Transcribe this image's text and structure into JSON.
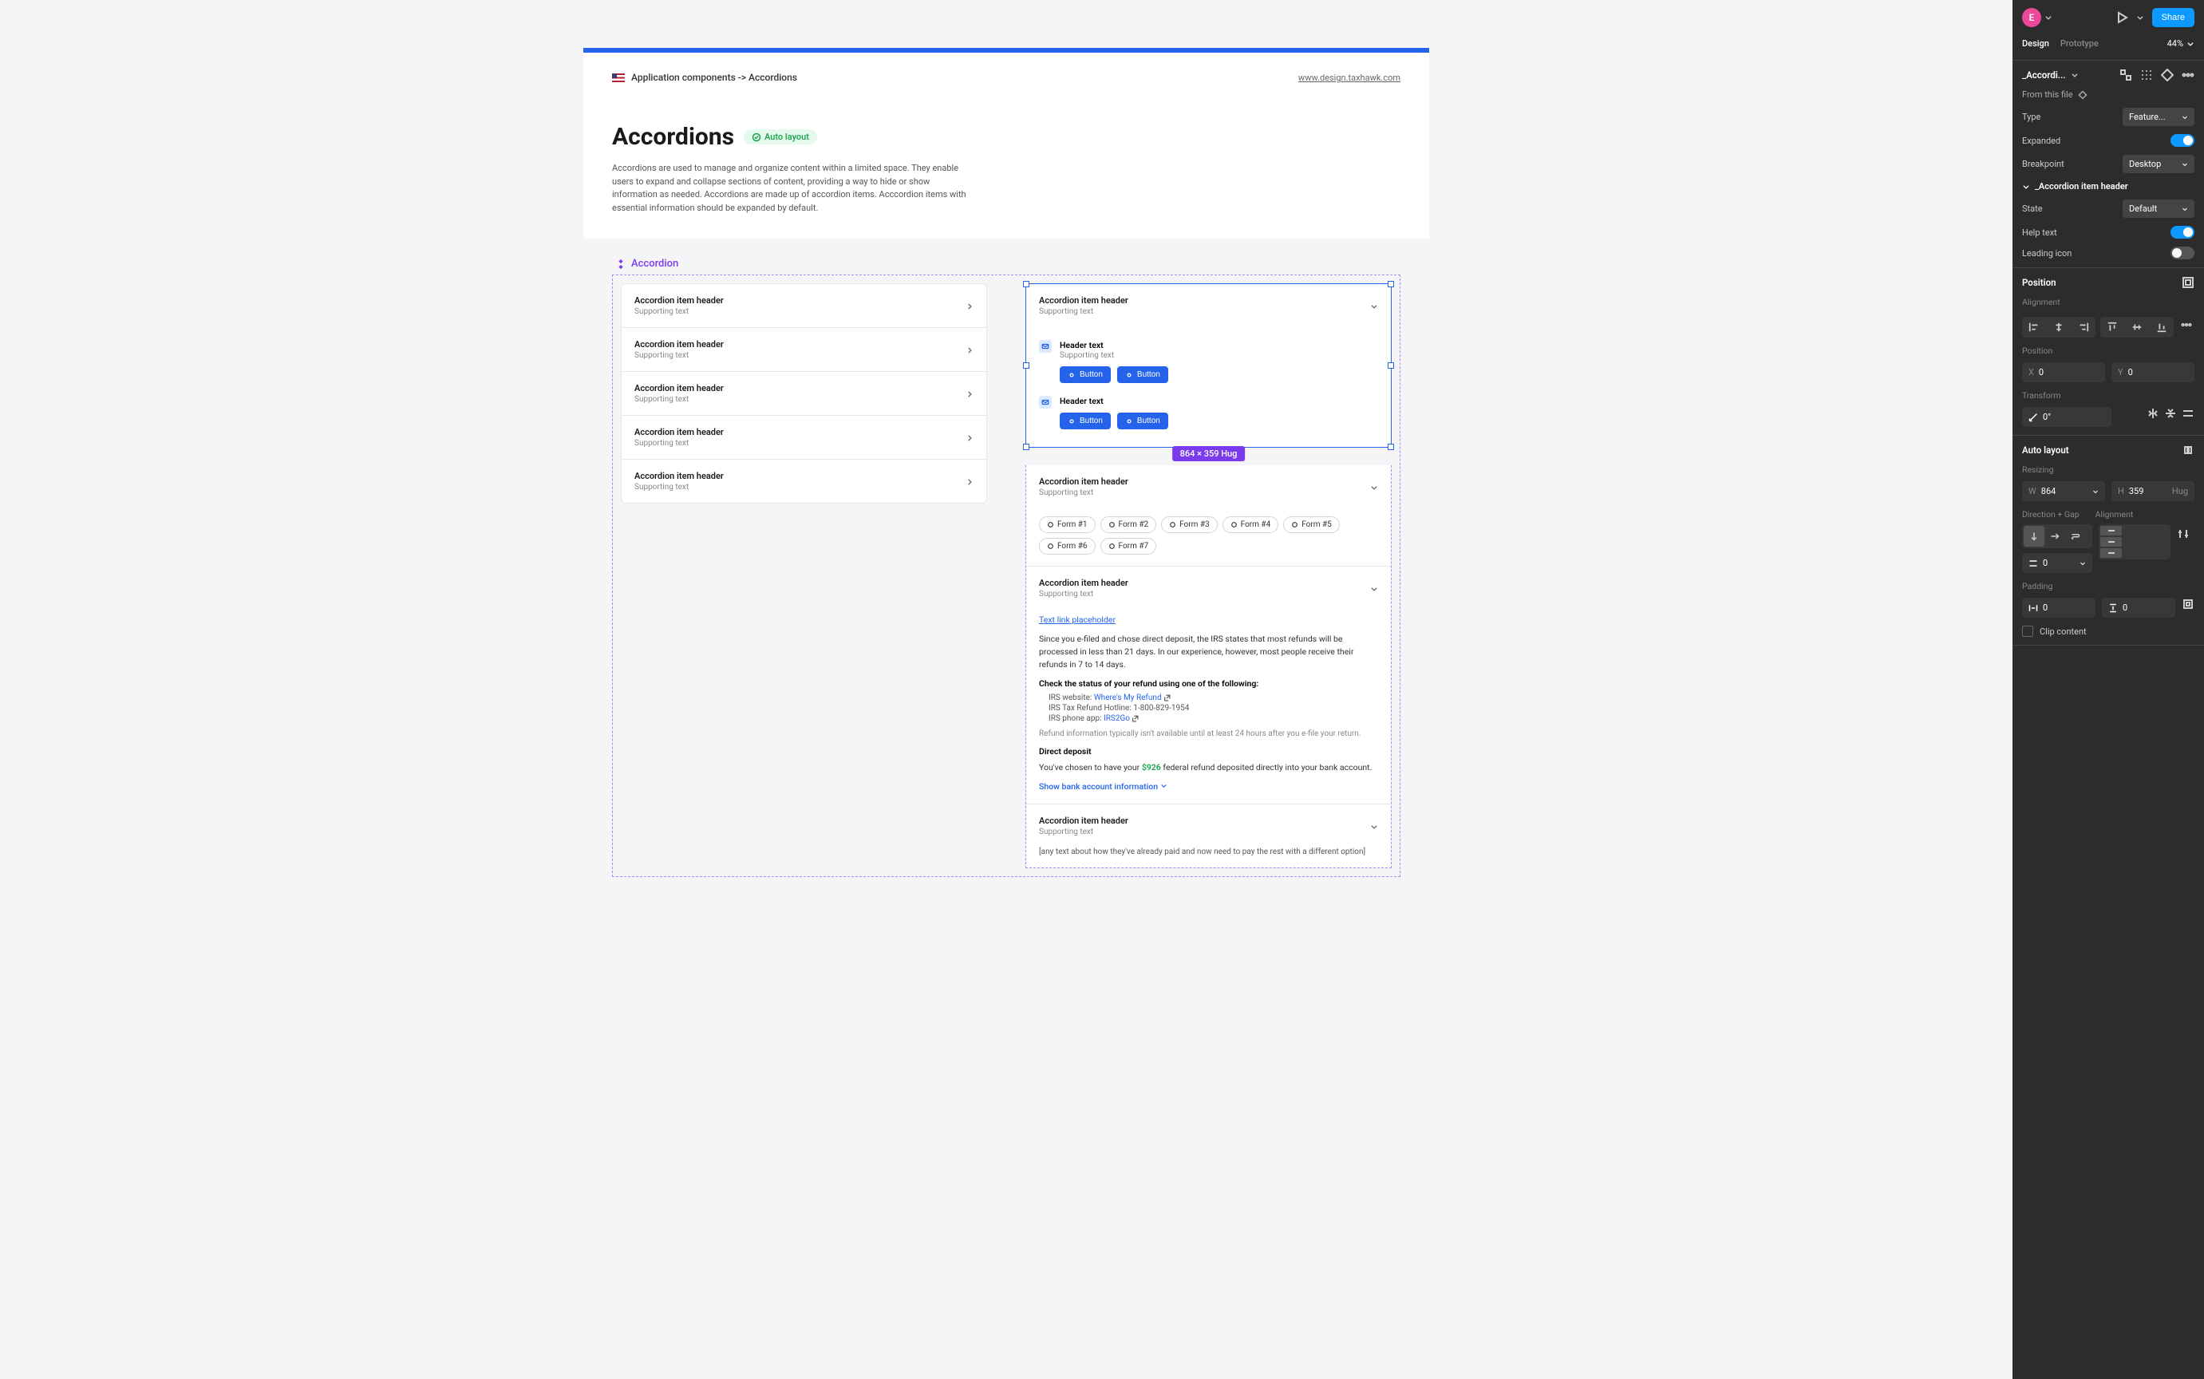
{
  "breadcrumb": "Application components -> Accordions",
  "header_link": "www.design.taxhawk.com",
  "page_title": "Accordions",
  "badge_text": "Auto layout",
  "page_desc": "Accordions are used to manage and organize content within a limited space. They enable users to expand and collapse sections of content, providing a way to hide or show information as needed. Accordions are made up of accordion items. Acccordion items with essential information should be expanded by default.",
  "component_label": "Accordion",
  "left_items": [
    {
      "hd": "Accordion item header",
      "sub": "Supporting text"
    },
    {
      "hd": "Accordion item header",
      "sub": "Supporting text"
    },
    {
      "hd": "Accordion item header",
      "sub": "Supporting text"
    },
    {
      "hd": "Accordion item header",
      "sub": "Supporting text"
    },
    {
      "hd": "Accordion item header",
      "sub": "Supporting text"
    }
  ],
  "selected": {
    "hd": "Accordion item header",
    "sub": "Supporting text",
    "block1": {
      "header": "Header text",
      "sub": "Supporting text",
      "btn1": "Button",
      "btn2": "Button"
    },
    "block2": {
      "header": "Header text",
      "btn1": "Button",
      "btn2": "Button"
    }
  },
  "dimension_label": "864 × 359 Hug",
  "forms_section": {
    "hd": "Accordion item header",
    "sub": "Supporting text",
    "chips": [
      "Form #1",
      "Form #2",
      "Form #3",
      "Form #4",
      "Form #5",
      "Form #6",
      "Form #7"
    ]
  },
  "rich_section": {
    "hd": "Accordion item header",
    "sub": "Supporting text",
    "link": "Text link placeholder",
    "body1": "Since you e-filed and chose direct deposit, the IRS states that most refunds will be processed in less than 21 days. In our experience, however, most people receive their refunds in 7 to 14 days.",
    "check_title": "Check the status of your refund using one of the following:",
    "lines": [
      {
        "pre": "IRS website: ",
        "link": "Where's My Refund",
        "ext": true
      },
      {
        "pre": "IRS Tax Refund Hotline: 1-800-829-1954",
        "link": "",
        "ext": false
      },
      {
        "pre": "IRS phone app: ",
        "link": "IRS2Go",
        "ext": true
      }
    ],
    "muted": "Refund information typically isn't available until at least 24 hours after you e-file your return.",
    "dd_title": "Direct deposit",
    "dd_text_pre": "You've chosen to have your ",
    "dd_amount": "$926",
    "dd_text_post": " federal refund deposited directly into your bank account.",
    "show_link": "Show bank account information"
  },
  "last_section": {
    "hd": "Accordion item header",
    "sub": "Supporting text",
    "bracket": "[any text about how they've already paid and now need to pay the rest with a different option]"
  },
  "panel": {
    "avatar": "E",
    "share": "Share",
    "tabs": {
      "design": "Design",
      "prototype": "Prototype"
    },
    "zoom": "44%",
    "comp_name": "_Accordi...",
    "from_file": "From this file",
    "props": {
      "type_label": "Type",
      "type_value": "Feature...",
      "expanded_label": "Expanded",
      "breakpoint_label": "Breakpoint",
      "breakpoint_value": "Desktop"
    },
    "nested_name": "_Accordion item header",
    "nested": {
      "state_label": "State",
      "state_value": "Default",
      "help_label": "Help text",
      "leading_label": "Leading icon"
    },
    "position": {
      "title": "Position",
      "alignment": "Alignment",
      "pos_label": "Position",
      "x": "0",
      "y": "0",
      "transform": "Transform",
      "rotation": "0°"
    },
    "autolayout": {
      "title": "Auto layout",
      "resizing": "Resizing",
      "w": "864",
      "h": "359",
      "hug": "Hug",
      "direction": "Direction + Gap",
      "alignment": "Alignment",
      "gap": "0",
      "padding": "Padding",
      "pad_h": "0",
      "pad_v": "0",
      "clip": "Clip content"
    }
  }
}
